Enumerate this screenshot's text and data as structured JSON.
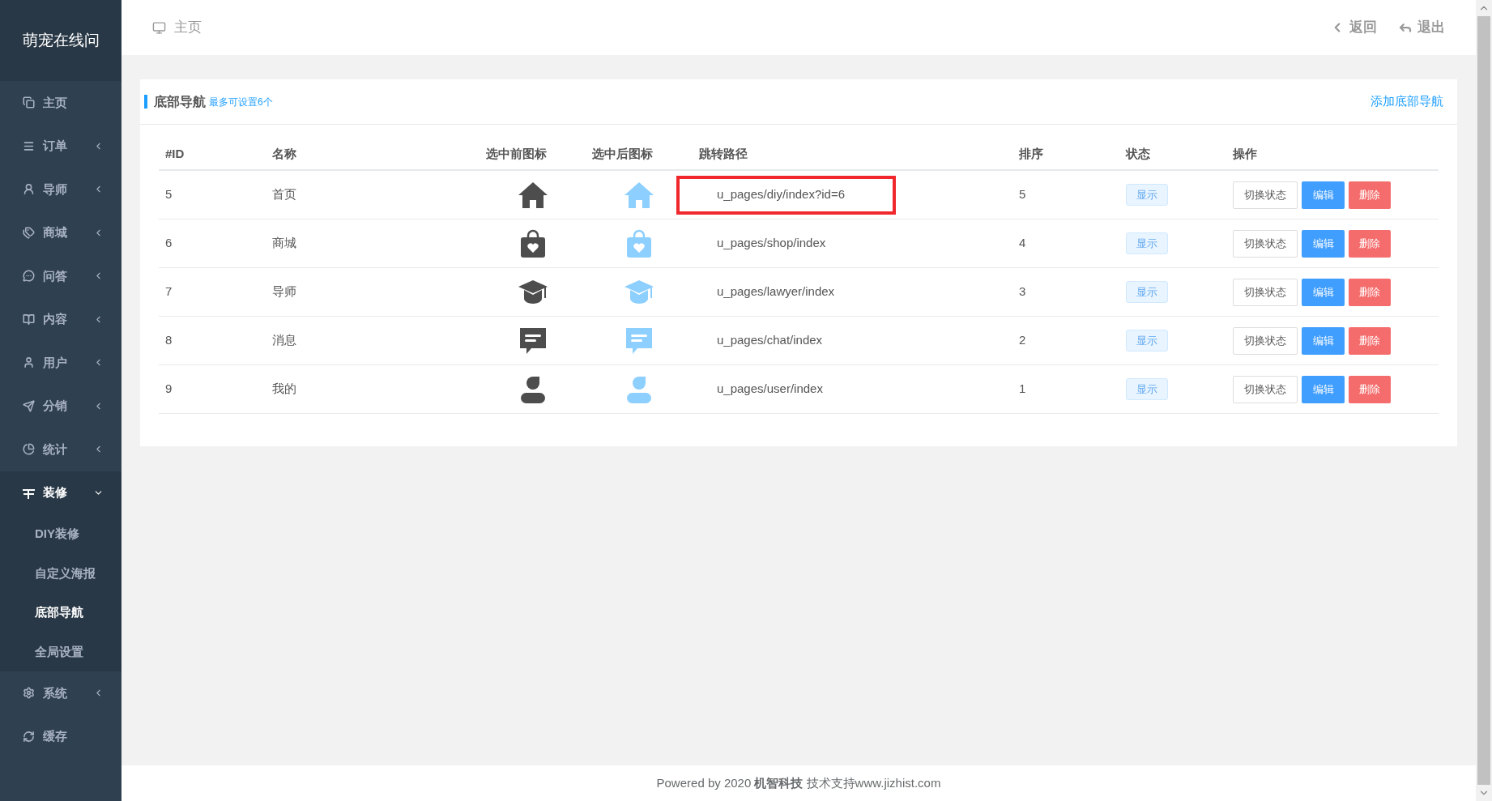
{
  "sidebar": {
    "logo": "萌宠在线问",
    "items": [
      {
        "label": "主页"
      },
      {
        "label": "订单",
        "expanded": false
      },
      {
        "label": "导师",
        "expanded": false
      },
      {
        "label": "商城",
        "expanded": false
      },
      {
        "label": "问答",
        "expanded": false
      },
      {
        "label": "内容",
        "expanded": false
      },
      {
        "label": "用户",
        "expanded": false
      },
      {
        "label": "分销",
        "expanded": false
      },
      {
        "label": "统计",
        "expanded": false
      },
      {
        "label": "装修",
        "expanded": true,
        "children": [
          {
            "label": "DIY装修",
            "selected": false
          },
          {
            "label": "自定义海报",
            "selected": false
          },
          {
            "label": "底部导航",
            "selected": true
          },
          {
            "label": "全局设置",
            "selected": false
          }
        ]
      },
      {
        "label": "系统",
        "expanded": false
      },
      {
        "label": "缓存"
      }
    ]
  },
  "topbar": {
    "breadcrumb": "主页",
    "back": "返回",
    "logout": "退出"
  },
  "card": {
    "title": "底部导航",
    "hint": "最多可设置6个",
    "add_link": "添加底部导航",
    "table": {
      "columns": [
        "#ID",
        "名称",
        "选中前图标",
        "选中后图标",
        "跳转路径",
        "排序",
        "状态",
        "操作"
      ],
      "rows": [
        {
          "id": "5",
          "name": "首页",
          "path": "u_pages/diy/index?id=6",
          "highlighted": true,
          "sort": "5",
          "status": "显示",
          "actions": [
            "切换状态",
            "编辑",
            "删除"
          ]
        },
        {
          "id": "6",
          "name": "商城",
          "path": "u_pages/shop/index",
          "highlighted": false,
          "sort": "4",
          "status": "显示",
          "actions": [
            "切换状态",
            "编辑",
            "删除"
          ]
        },
        {
          "id": "7",
          "name": "导师",
          "path": "u_pages/lawyer/index",
          "highlighted": false,
          "sort": "3",
          "status": "显示",
          "actions": [
            "切换状态",
            "编辑",
            "删除"
          ]
        },
        {
          "id": "8",
          "name": "消息",
          "path": "u_pages/chat/index",
          "highlighted": false,
          "sort": "2",
          "status": "显示",
          "actions": [
            "切换状态",
            "编辑",
            "删除"
          ]
        },
        {
          "id": "9",
          "name": "我的",
          "path": "u_pages/user/index",
          "highlighted": false,
          "sort": "1",
          "status": "显示",
          "actions": [
            "切换状态",
            "编辑",
            "删除"
          ]
        }
      ]
    }
  },
  "footer": "Powered by 2020 **机智科技** 技术支持www.jizhist.com"
}
